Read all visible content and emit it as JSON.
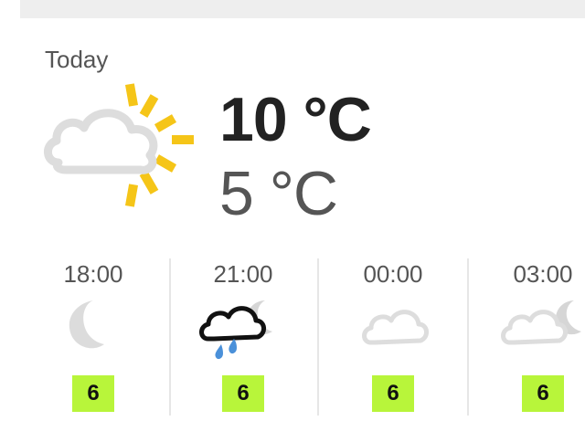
{
  "today": {
    "label": "Today",
    "condition_icon": "partly-cloudy-sun-icon",
    "high_temp": "10 °C",
    "low_temp": "5 °C",
    "colors": {
      "sun": "#f5c518",
      "cloud": "#dddddd"
    }
  },
  "hourly": [
    {
      "time": "18:00",
      "icon": "moon-icon",
      "uv": "6"
    },
    {
      "time": "21:00",
      "icon": "rain-cloud-moon-icon",
      "uv": "6"
    },
    {
      "time": "00:00",
      "icon": "cloud-icon",
      "uv": "6"
    },
    {
      "time": "03:00",
      "icon": "cloud-moon-icon",
      "uv": "6"
    }
  ],
  "colors": {
    "uv_badge": "#b8f53a",
    "rain": "#4a90d9"
  }
}
